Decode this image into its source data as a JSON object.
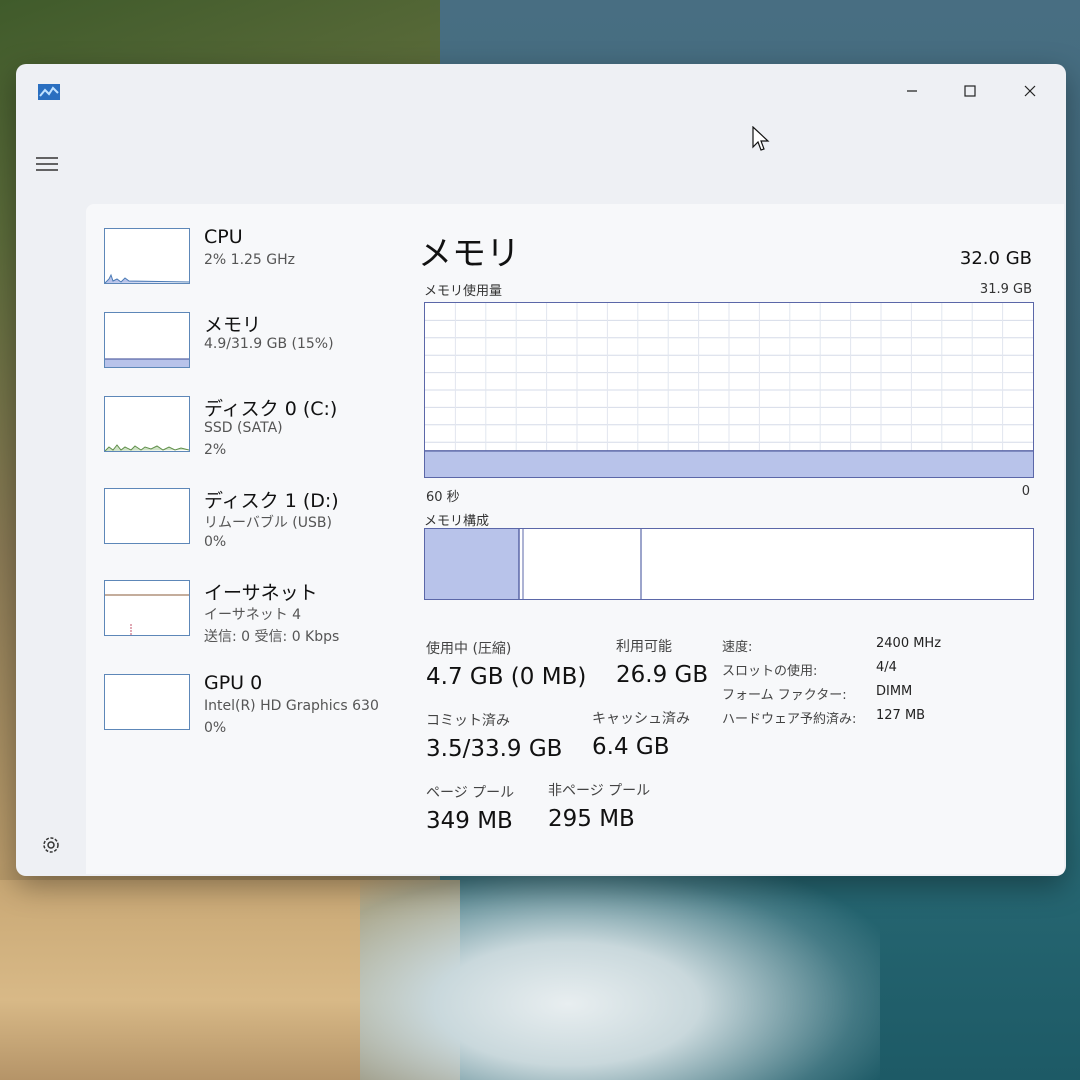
{
  "sidebar": {
    "items": [
      {
        "title": "CPU",
        "line1": "2%  1.25 GHz",
        "line2": ""
      },
      {
        "title": "メモリ",
        "line1": "4.9/31.9 GB (15%)",
        "line2": ""
      },
      {
        "title": "ディスク 0 (C:)",
        "line1": "SSD (SATA)",
        "line2": "2%"
      },
      {
        "title": "ディスク 1 (D:)",
        "line1": "リムーバブル (USB)",
        "line2": "0%"
      },
      {
        "title": "イーサネット",
        "line1": "イーサネット 4",
        "line2": "送信: 0 受信: 0 Kbps"
      },
      {
        "title": "GPU 0",
        "line1": "Intel(R) HD Graphics 630",
        "line2": "0%"
      }
    ]
  },
  "main": {
    "title": "メモリ",
    "total": "32.0 GB",
    "usage_label": "メモリ使用量",
    "usage_max": "31.9 GB",
    "usage_fraction": 0.15,
    "time_left": "60 秒",
    "time_right": "0",
    "composition_label": "メモリ構成",
    "stats": {
      "in_use_label": "使用中 (圧縮)",
      "in_use_value": "4.7 GB (0 MB)",
      "available_label": "利用可能",
      "available_value": "26.9 GB",
      "committed_label": "コミット済み",
      "committed_value": "3.5/33.9 GB",
      "cached_label": "キャッシュ済み",
      "cached_value": "6.4 GB",
      "paged_label": "ページ プール",
      "paged_value": "349 MB",
      "nonpaged_label": "非ページ プール",
      "nonpaged_value": "295 MB"
    },
    "details": [
      {
        "key": "速度:",
        "value": "2400 MHz"
      },
      {
        "key": "スロットの使用:",
        "value": "4/4"
      },
      {
        "key": "フォーム ファクター:",
        "value": "DIMM"
      },
      {
        "key": "ハードウェア予約済み:",
        "value": "127 MB"
      }
    ]
  },
  "colors": {
    "accent": "#5b67a8",
    "memory_fill": "#b8c3ea",
    "mini_border": "#5d87b8"
  }
}
